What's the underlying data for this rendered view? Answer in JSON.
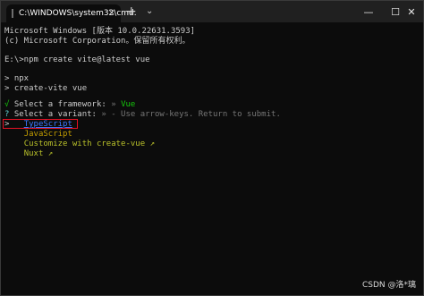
{
  "titlebar": {
    "tab_title": "C:\\WINDOWS\\system32\\cmd.",
    "tab_close": "×",
    "new_tab": "+",
    "tab_menu": "⌄",
    "minimize": "—",
    "maximize": "☐",
    "close": "✕"
  },
  "terminal": {
    "line1": "Microsoft Windows [版本 10.0.22631.3593]",
    "line2": "(c) Microsoft Corporation。保留所有权利。",
    "line3": "E:\\>npm create vite@latest vue",
    "line4": "> npx",
    "line5": "> create-vite vue",
    "check_mark": "√",
    "framework_prompt": " Select a framework: ",
    "framework_sep": "» ",
    "framework_value": "Vue",
    "question_mark": "?",
    "variant_prompt": " Select a variant: ",
    "variant_hint": "» - Use arrow-keys. Return to submit.",
    "cursor": ">",
    "options": [
      "TypeScript",
      "JavaScript",
      "Customize with create-vue ↗",
      "Nuxt ↗"
    ]
  },
  "watermark": "CSDN @洛*璃"
}
